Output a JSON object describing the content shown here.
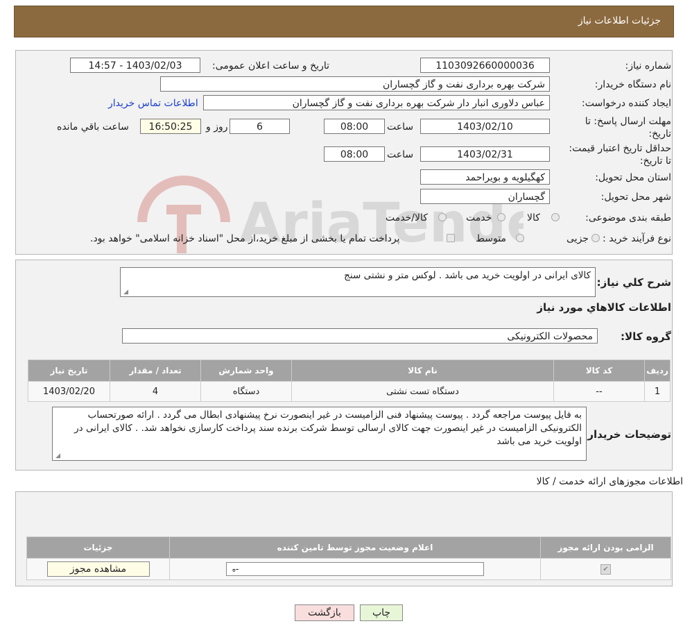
{
  "header": {
    "title": "جزئیات اطلاعات نیاز"
  },
  "form": {
    "need_number_label": "شماره نیاز:",
    "need_number": "1103092660000036",
    "announce_label": "تاریخ و ساعت اعلان عمومی:",
    "announce_value": "1403/02/03 - 14:57",
    "buyer_label": "نام دستگاه خریدار:",
    "buyer_value": "شرکت بهره برداری نفت و گاز گچساران",
    "creator_label": "ایجاد کننده درخواست:",
    "creator_value": "عباس دلاوری انبار دار شرکت بهره برداری نفت و گاز گچساران",
    "contact_link": "اطلاعات تماس خریدار",
    "deadline_label": "مهلت ارسال پاسخ: تا تاریخ:",
    "deadline_date": "1403/02/10",
    "time_label": "ساعت",
    "deadline_time": "08:00",
    "days_value": "6",
    "days_label": "روز و",
    "remaining_time": "16:50:25",
    "remaining_label": "ساعت باقي مانده",
    "validity_label": "حداقل تاریخ اعتبار قیمت: تا تاریخ:",
    "validity_date": "1403/02/31",
    "validity_time": "08:00",
    "province_label": "استان محل تحویل:",
    "province_value": "کهگیلویه و بویراحمد",
    "city_label": "شهر محل تحویل:",
    "city_value": "گچساران",
    "category_label": "طبقه بندی موضوعی:",
    "category_options": [
      "کالا",
      "خدمت",
      "کالا/خدمت"
    ],
    "process_label": "نوع فرآیند خرید :",
    "process_options": [
      "جزیی",
      "متوسط"
    ],
    "process_note": "پرداخت تمام یا بخشی از مبلغ خرید،از محل \"اسناد خزانه اسلامی\" خواهد بود."
  },
  "description": {
    "label": "شرح کلي نياز:",
    "value": "کالای ایرانی در اولویت خرید می باشد . لوکس متر و نشتی سنج"
  },
  "goods": {
    "section_title": "اطلاعات کالاهاي مورد نياز",
    "group_label": "گروه کالا:",
    "group_value": "محصولات الکترونیکی",
    "columns": [
      "رديف",
      "کد کالا",
      "نام کالا",
      "واحد شمارش",
      "تعداد / مقدار",
      "تاريخ نياز"
    ],
    "rows": [
      [
        "1",
        "--",
        "دستگاه تست نشتی",
        "دستگاه",
        "4",
        "1403/02/20"
      ]
    ]
  },
  "buyer_notes": {
    "label": "توضیحات خریدار:",
    "value": "به فایل پیوست مراجعه گردد . پیوست پیشنهاد فنی الزامیست در غیر اینصورت نرخ پیشنهادی ابطال می گردد . ارائه صورتحساب الکترونیکی الزامیست در غیر اینصورت جهت کالای ارسالی توسط شرکت برنده سند پرداخت کارسازی نخواهد شد. . کالای ایرانی در اولویت خرید می باشد"
  },
  "permits": {
    "section_title": "اطلاعات مجوزهای ارائه خدمت / کالا",
    "columns": [
      "الزامی بودن ارائه مجوز",
      "اعلام وضعیت مجوز توسط تامین کننده",
      "جزئیات"
    ],
    "select_value": "--",
    "view_button": "مشاهده مجوز"
  },
  "footer": {
    "print_button": "چاپ",
    "back_button": "بازگشت"
  },
  "watermark": {
    "text": "AriaTender.neT"
  },
  "colors": {
    "header": "#8c6a3f",
    "link": "#1a3fd1",
    "table_header": "#a3a3a3",
    "print_btn": "#e8f6d8",
    "back_btn": "#f9dede"
  }
}
